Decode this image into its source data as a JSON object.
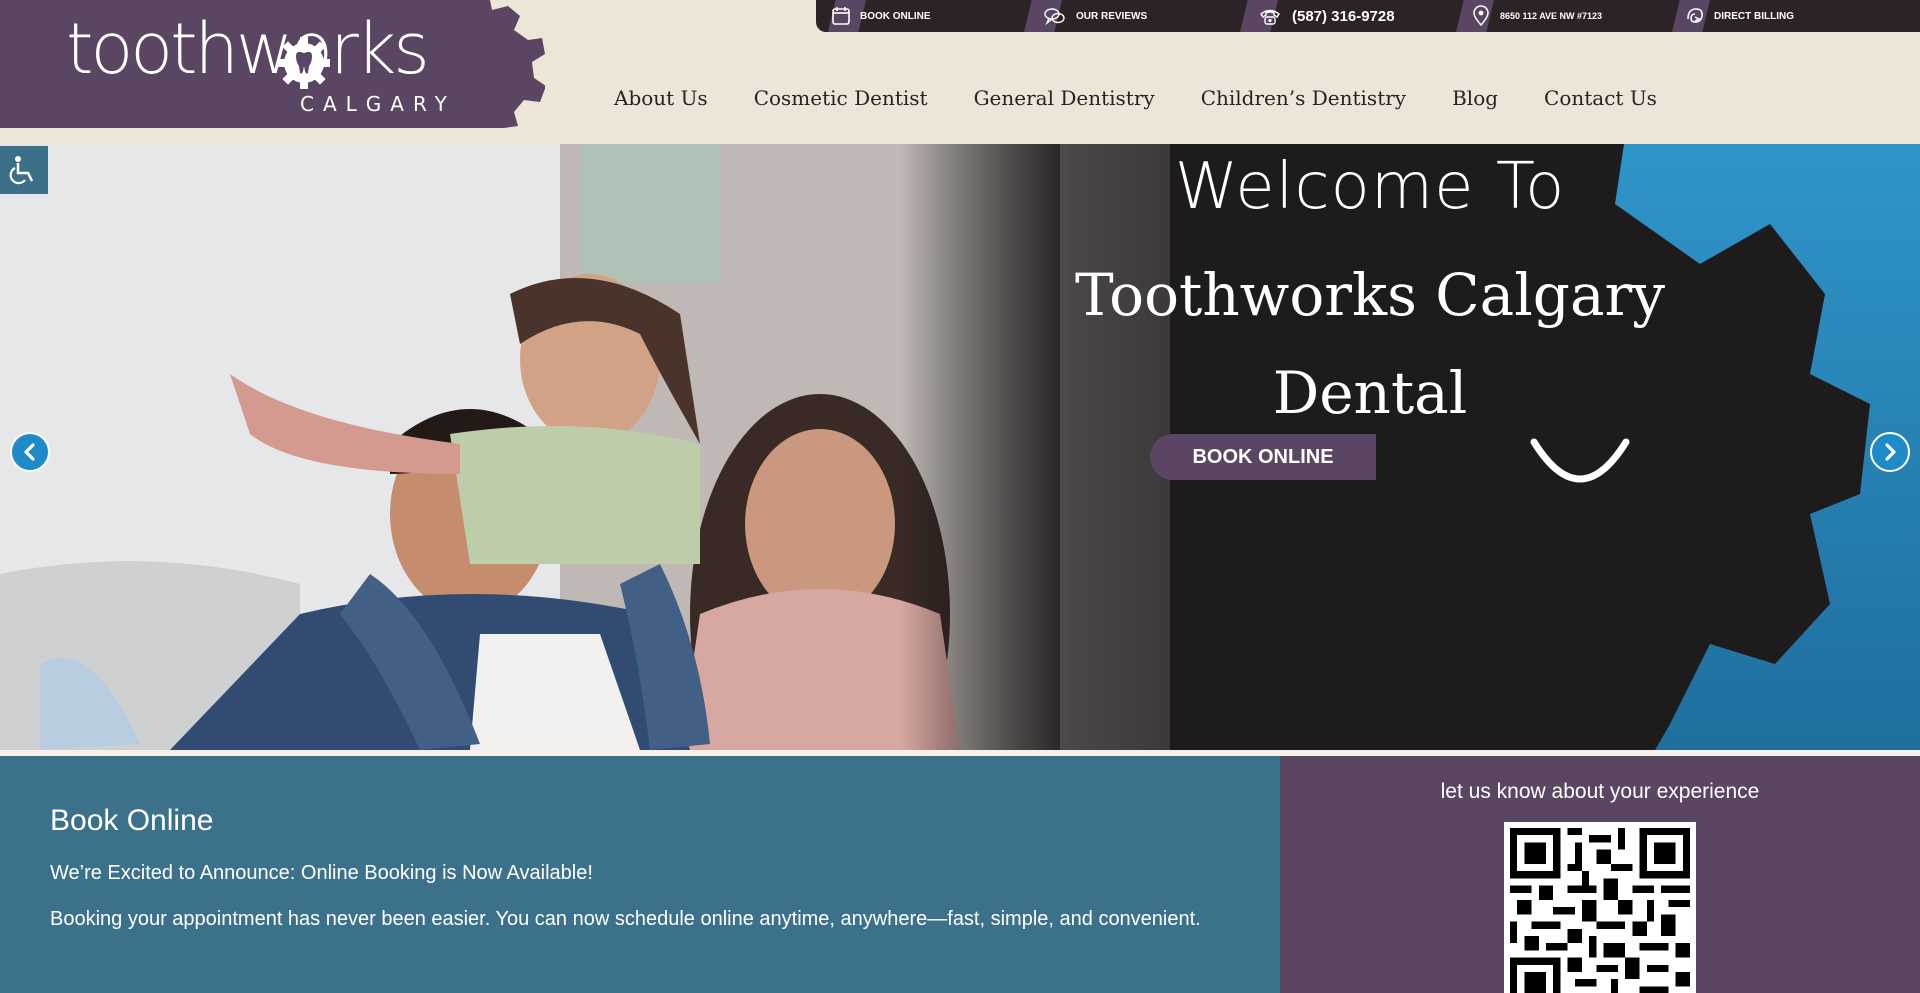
{
  "header": {
    "logo_main": "toothworks",
    "logo_sub": "CALGARY",
    "topbar": {
      "book_online": "BOOK ONLINE",
      "reviews": "OUR REVIEWS",
      "phone": "(587) 316-9728",
      "address": "8650 112 AVE NW #7123",
      "direct_billing": "DIRECT BILLING"
    },
    "nav": [
      "About Us",
      "Cosmetic Dentist",
      "General Dentistry",
      "Children’s Dentistry",
      "Blog",
      "Contact Us"
    ]
  },
  "hero": {
    "welcome": "Welcome To",
    "practice_line1": "Toothworks Calgary",
    "practice_line2": "Dental",
    "cta": "BOOK ONLINE"
  },
  "booking": {
    "title": "Book Online",
    "line1": "We’re Excited to Announce: Online Booking is Now Available!",
    "line2": "Booking your appointment has never been easier. You can now schedule online anytime, anywhere—fast, simple, and convenient."
  },
  "feedback": {
    "text": "let us know about your experience"
  },
  "icons": {
    "accessibility": "wheelchair-icon",
    "calendar": "calendar-icon",
    "reviews": "speech-bubbles-icon",
    "phone": "phone-icon",
    "location": "map-pin-icon",
    "billing": "billing-icon",
    "prev": "chevron-left-icon",
    "next": "chevron-right-icon"
  },
  "colors": {
    "brand_purple": "#5a4562",
    "topbar_dark": "#2b2325",
    "header_beige": "#ede6d8",
    "teal": "#3c718b",
    "accent_blue": "#1e8bc9"
  }
}
